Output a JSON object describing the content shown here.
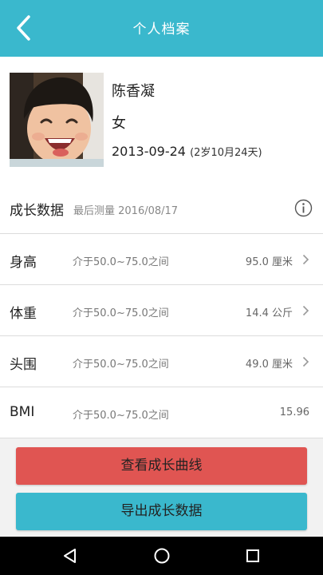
{
  "appbar": {
    "title": "个人档案",
    "color": "#3ab8cd",
    "back_icon": "chevron-left-icon"
  },
  "profile": {
    "avatar_icon": "child-photo",
    "name": "陈香凝",
    "gender": "女",
    "birthdate": "2013-09-24",
    "age": "(2岁10月24天)"
  },
  "growth": {
    "title": "成长数据",
    "last_measured": "最后测量 2016/08/17",
    "info_icon": "info-icon",
    "rows": [
      {
        "label": "身高",
        "range": "介于50.0~75.0之间",
        "value": "95.0 厘米"
      },
      {
        "label": "体重",
        "range": "介于50.0~75.0之间",
        "value": "14.4 公斤"
      },
      {
        "label": "头围",
        "range": "介于50.0~75.0之间",
        "value": "49.0 厘米"
      },
      {
        "label": "BMI",
        "range": "介于50.0~75.0之间",
        "value": "15.96"
      }
    ]
  },
  "actions": {
    "view_curve": "查看成长曲线",
    "view_curve_color": "#e05552",
    "export_data": "导出成长数据",
    "export_data_color": "#3ab8cd"
  },
  "system_nav": {
    "back_icon": "nav-back-icon",
    "home_icon": "nav-home-icon",
    "recents_icon": "nav-recents-icon"
  }
}
